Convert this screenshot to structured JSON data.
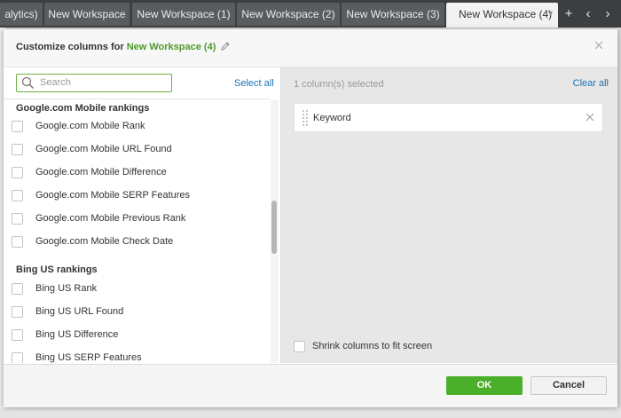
{
  "tabs": [
    {
      "label": "alytics)",
      "active": false
    },
    {
      "label": "New Workspace",
      "active": false
    },
    {
      "label": "New Workspace (1)",
      "active": false
    },
    {
      "label": "New Workspace (2)",
      "active": false
    },
    {
      "label": "New Workspace (3)",
      "active": false
    },
    {
      "label": "New Workspace (4)",
      "active": true
    }
  ],
  "tabbar_icons": {
    "add": "plus-icon",
    "prev": "chevron-left-icon",
    "next": "chevron-right-icon",
    "menu": "chevron-down-icon"
  },
  "dialog": {
    "title_prefix": "Customize columns for",
    "workspace_name": "New Workspace (4)",
    "edit_icon": "pencil-icon",
    "close_icon": "close-icon"
  },
  "left_pane": {
    "search_placeholder": "Search",
    "select_all_label": "Select all",
    "groups": [
      {
        "heading": "Google.com Mobile rankings",
        "items": [
          {
            "label": "Google.com Mobile Rank",
            "checked": false
          },
          {
            "label": "Google.com Mobile URL Found",
            "checked": false
          },
          {
            "label": "Google.com Mobile Difference",
            "checked": false
          },
          {
            "label": "Google.com Mobile SERP Features",
            "checked": false
          },
          {
            "label": "Google.com Mobile Previous Rank",
            "checked": false
          },
          {
            "label": "Google.com Mobile Check Date",
            "checked": false
          }
        ]
      },
      {
        "heading": "Bing US rankings",
        "items": [
          {
            "label": "Bing US Rank",
            "checked": false
          },
          {
            "label": "Bing US URL Found",
            "checked": false
          },
          {
            "label": "Bing US Difference",
            "checked": false
          },
          {
            "label": "Bing US SERP Features",
            "checked": false
          }
        ]
      }
    ]
  },
  "right_pane": {
    "selected_count_text": "1 column(s) selected",
    "clear_all_label": "Clear all",
    "selected_columns": [
      {
        "label": "Keyword"
      }
    ],
    "shrink_label": "Shrink columns to fit screen",
    "shrink_checked": false
  },
  "footer": {
    "ok_label": "OK",
    "cancel_label": "Cancel"
  },
  "colors": {
    "accent_green": "#4caf2a",
    "link_blue": "#1a73b8",
    "workspace_green": "#4e9a2b"
  }
}
